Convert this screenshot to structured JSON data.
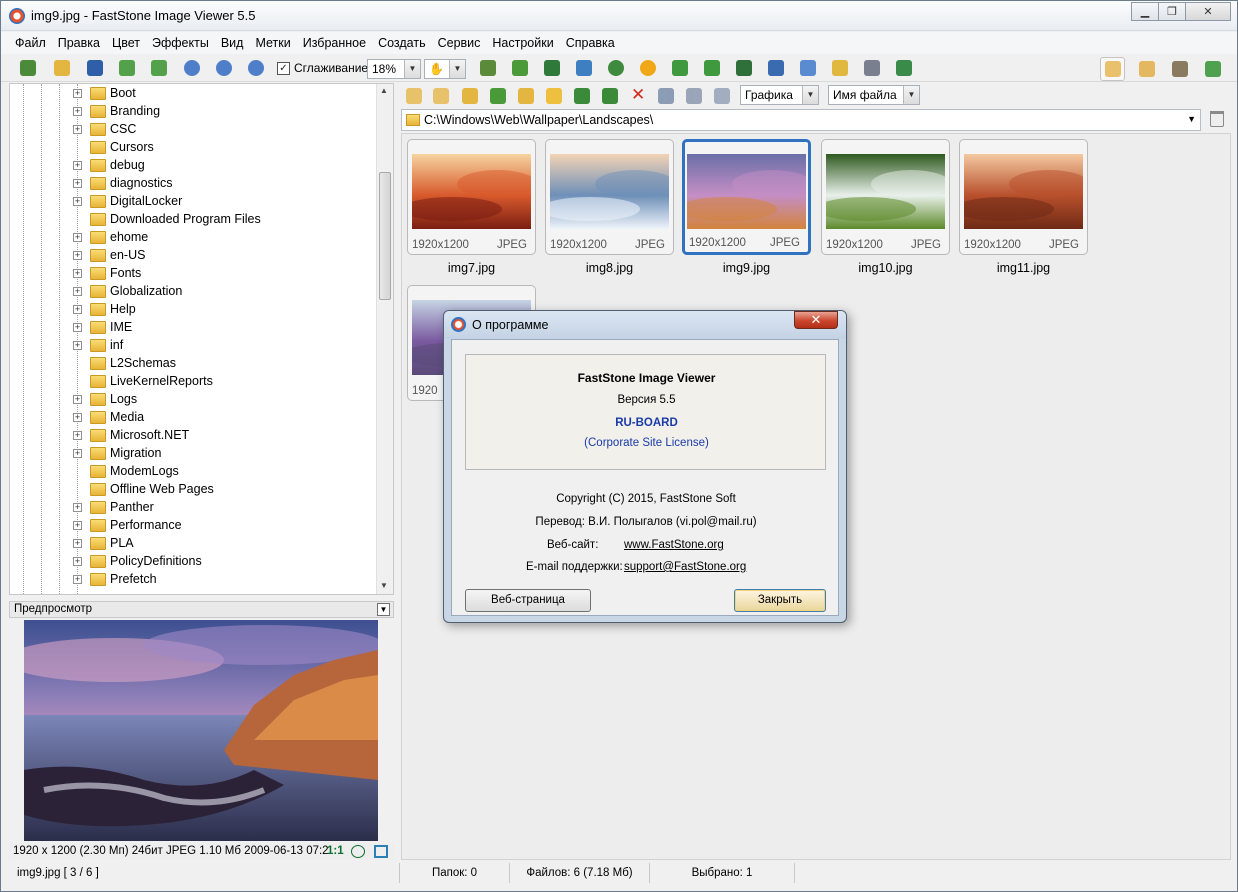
{
  "window": {
    "title": "img9.jpg  -  FastStone Image Viewer 5.5",
    "controls": [
      "minimize",
      "maximize",
      "close"
    ]
  },
  "menu": [
    "Файл",
    "Правка",
    "Цвет",
    "Эффекты",
    "Вид",
    "Метки",
    "Избранное",
    "Создать",
    "Сервис",
    "Настройки",
    "Справка"
  ],
  "toolbar": {
    "smoothing_label": "Сглаживание",
    "smoothing_checked": true,
    "zoom_value": "18%"
  },
  "browser_toolbar": {
    "filter_value": "Графика",
    "sort_value": "Имя файла"
  },
  "tree": {
    "items": [
      {
        "label": "Boot",
        "expandable": true
      },
      {
        "label": "Branding",
        "expandable": true
      },
      {
        "label": "CSC",
        "expandable": true
      },
      {
        "label": "Cursors",
        "expandable": false
      },
      {
        "label": "debug",
        "expandable": true
      },
      {
        "label": "diagnostics",
        "expandable": true
      },
      {
        "label": "DigitalLocker",
        "expandable": true
      },
      {
        "label": "Downloaded Program Files",
        "expandable": false
      },
      {
        "label": "ehome",
        "expandable": true
      },
      {
        "label": "en-US",
        "expandable": true
      },
      {
        "label": "Fonts",
        "expandable": true
      },
      {
        "label": "Globalization",
        "expandable": true
      },
      {
        "label": "Help",
        "expandable": true
      },
      {
        "label": "IME",
        "expandable": true
      },
      {
        "label": "inf",
        "expandable": true
      },
      {
        "label": "L2Schemas",
        "expandable": false
      },
      {
        "label": "LiveKernelReports",
        "expandable": false
      },
      {
        "label": "Logs",
        "expandable": true
      },
      {
        "label": "Media",
        "expandable": true
      },
      {
        "label": "Microsoft.NET",
        "expandable": true
      },
      {
        "label": "Migration",
        "expandable": true
      },
      {
        "label": "ModemLogs",
        "expandable": false
      },
      {
        "label": "Offline Web Pages",
        "expandable": false
      },
      {
        "label": "Panther",
        "expandable": true
      },
      {
        "label": "Performance",
        "expandable": true
      },
      {
        "label": "PLA",
        "expandable": true
      },
      {
        "label": "PolicyDefinitions",
        "expandable": true
      },
      {
        "label": "Prefetch",
        "expandable": true
      }
    ]
  },
  "preview": {
    "header": "Предпросмотр",
    "info": "1920 x 1200 (2.30 Мп)  24бит  JPEG   1.10 Мб   2009-06-13 07:2",
    "actual_size_label": "1:1"
  },
  "browser": {
    "path": "C:\\Windows\\Web\\Wallpaper\\Landscapes\\",
    "thumbnails": [
      {
        "name": "img7.jpg",
        "resolution": "1920x1200",
        "format": "JPEG",
        "selected": false,
        "palette": [
          "#f6d3a0",
          "#d85a2c",
          "#7a1e12"
        ]
      },
      {
        "name": "img8.jpg",
        "resolution": "1920x1200",
        "format": "JPEG",
        "selected": false,
        "palette": [
          "#f2d3b5",
          "#6e8fb8",
          "#eef4fb"
        ]
      },
      {
        "name": "img9.jpg",
        "resolution": "1920x1200",
        "format": "JPEG",
        "selected": true,
        "palette": [
          "#6a6fa8",
          "#c48ec4",
          "#d3843c"
        ]
      },
      {
        "name": "img10.jpg",
        "resolution": "1920x1200",
        "format": "JPEG",
        "selected": false,
        "palette": [
          "#2f5a1f",
          "#e8f0ea",
          "#5d8a2a"
        ]
      },
      {
        "name": "img11.jpg",
        "resolution": "1920x1200",
        "format": "JPEG",
        "selected": false,
        "palette": [
          "#f4c9a0",
          "#b8502c",
          "#6e2a15"
        ]
      },
      {
        "name": "",
        "resolution": "1920",
        "format": "",
        "selected": false,
        "palette": [
          "#c6d4e4",
          "#7a5aa0",
          "#5a4a78"
        ]
      }
    ]
  },
  "statusbar": {
    "file": "img9.jpg [ 3 / 6 ]",
    "folders": "Папок: 0",
    "files": "Файлов: 6 (7.18 Мб)",
    "selected": "Выбрано: 1"
  },
  "about_dialog": {
    "title": "О программе",
    "product": "FastStone Image Viewer",
    "version": "Версия 5.5",
    "licensee": "RU-BOARD",
    "license": "(Corporate Site License)",
    "copyright": "Copyright (C) 2015, FastStone Soft",
    "translation": "Перевод: В.И. Полыгалов (vi.pol@mail.ru)",
    "website_label": "Веб-сайт:",
    "website": "www.FastStone.org",
    "support_label": "E-mail поддержки:",
    "support": "support@FastStone.org",
    "web_button": "Веб-страница",
    "close_button": "Закрыть"
  },
  "colors": {
    "selection": "#3072bf",
    "licensee": "#1a3aa8",
    "accent_green": "#0c6d2f"
  }
}
